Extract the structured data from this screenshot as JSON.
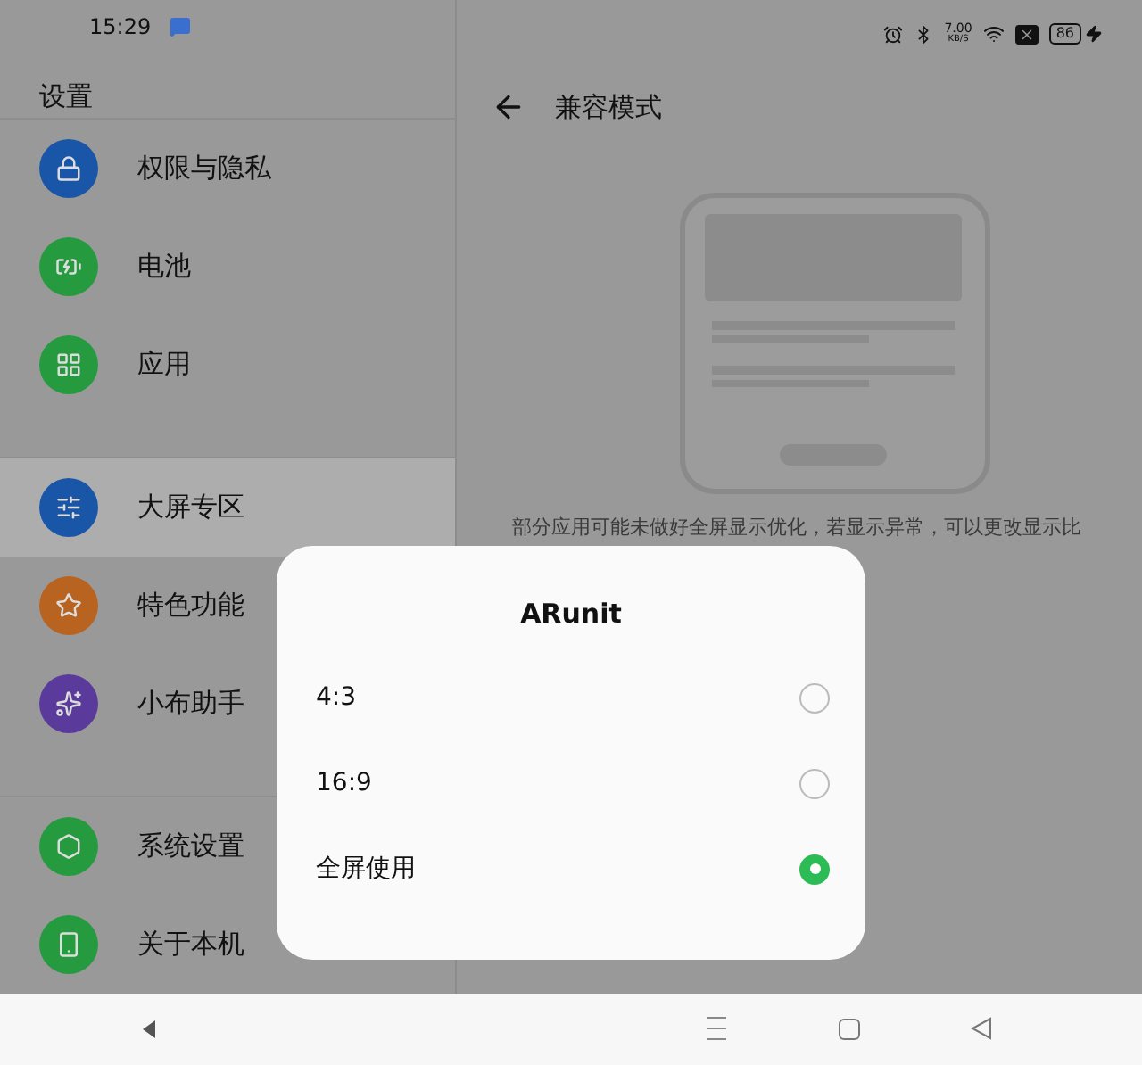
{
  "status_bar": {
    "time": "15:29",
    "net_speed": "7.00",
    "net_unit": "KB/S",
    "battery": "86"
  },
  "sidebar": {
    "title": "设置",
    "groups": [
      {
        "items": [
          {
            "label": "权限与隐私",
            "color": "#1a56a8",
            "selected": false
          },
          {
            "label": "电池",
            "color": "#259a3f",
            "selected": false
          },
          {
            "label": "应用",
            "color": "#259a3f",
            "selected": false
          }
        ]
      },
      {
        "items": [
          {
            "label": "大屏专区",
            "color": "#1a56a8",
            "selected": true
          },
          {
            "label": "特色功能",
            "color": "#b86420",
            "selected": false
          },
          {
            "label": "小布助手",
            "color": "#5a3a9a",
            "selected": false
          }
        ]
      },
      {
        "items": [
          {
            "label": "系统设置",
            "color": "#259a3f",
            "selected": false
          },
          {
            "label": "关于本机",
            "color": "#259a3f",
            "selected": false
          }
        ]
      }
    ]
  },
  "page": {
    "title": "兼容模式",
    "description": "部分应用可能未做好全屏显示优化，若显示异常，可以更改显示比"
  },
  "dialog": {
    "title": "ARunit",
    "options": [
      {
        "label": "4:3",
        "selected": false
      },
      {
        "label": "16:9",
        "selected": false
      },
      {
        "label": "全屏使用",
        "selected": true
      }
    ]
  }
}
